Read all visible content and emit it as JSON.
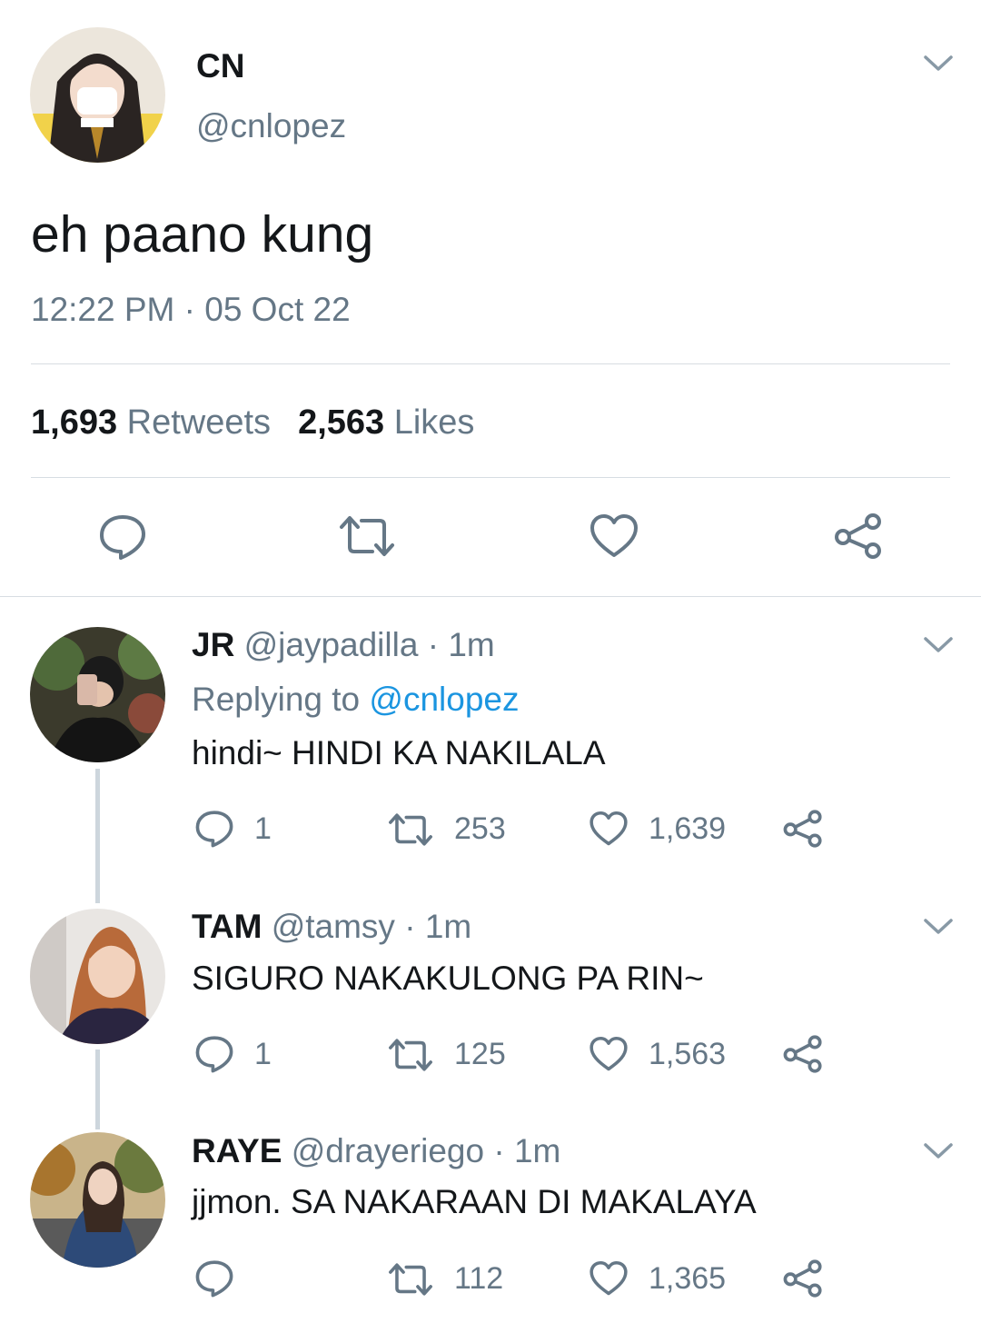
{
  "tweet": {
    "display_name": "CN",
    "handle": "@cnlopez",
    "text": "eh paano kung",
    "timestamp": "12:22 PM · 05 Oct 22",
    "retweets_count": "1,693",
    "retweets_label": "Retweets",
    "likes_count": "2,563",
    "likes_label": "Likes"
  },
  "replies": [
    {
      "display_name": "JR",
      "handle": "@jaypadilla",
      "time": "· 1m",
      "replying_label": "Replying to",
      "replying_to": "@cnlopez",
      "text": "hindi~ HINDI KA NAKILALA",
      "reply_count": "1",
      "retweet_count": "253",
      "like_count": "1,639"
    },
    {
      "display_name": "TAM",
      "handle": "@tamsy",
      "time": "· 1m",
      "text": "SIGURO NAKAKULONG PA RIN~",
      "reply_count": "1",
      "retweet_count": "125",
      "like_count": "1,563"
    },
    {
      "display_name": "RAYE",
      "handle": "@drayeriego",
      "time": "· 1m",
      "text": "jjmon. SA NAKARAAN DI MAKALAYA",
      "reply_count": "",
      "retweet_count": "112",
      "like_count": "1,365"
    }
  ],
  "icons": {
    "reply": "reply-icon",
    "retweet": "retweet-icon",
    "like": "heart-icon",
    "share": "share-icon",
    "more": "chevron-down-icon"
  },
  "colors": {
    "text": "#14171a",
    "secondary": "#657786",
    "link": "#1b95e0",
    "divider": "#d7dde2"
  }
}
